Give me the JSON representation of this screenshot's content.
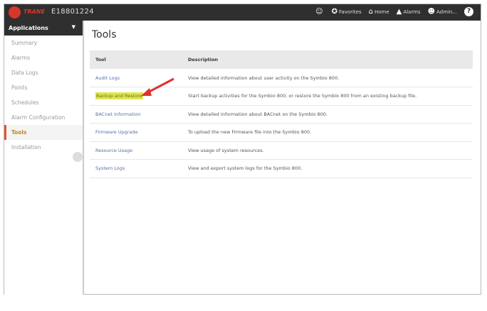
{
  "topbar": {
    "brand": "TRANE",
    "device": "E18801224",
    "nav": [
      {
        "icon": "user-icon",
        "label": ""
      },
      {
        "icon": "star-icon",
        "label": "Favorites"
      },
      {
        "icon": "home-icon",
        "label": "Home"
      },
      {
        "icon": "bell-icon",
        "label": "Alarms"
      },
      {
        "icon": "users-icon",
        "label": "Admin..."
      }
    ],
    "help": "?"
  },
  "sidebar": {
    "header": "Applications",
    "items": [
      "Summary",
      "Alarms",
      "Data Logs",
      "Points",
      "Schedules",
      "Alarm Configuration",
      "Tools",
      "Installation"
    ],
    "active": "Tools"
  },
  "main": {
    "title": "Tools",
    "columns": [
      "Tool",
      "Description"
    ],
    "rows": [
      {
        "tool": "Audit Logs",
        "desc": "View detailed information about user activity on the Symbio 800."
      },
      {
        "tool": "Backup and Restore",
        "desc": "Start backup activities for the Symbio 800, or restore the Symbio 800 from an existing backup file."
      },
      {
        "tool": "BACnet Information",
        "desc": "View detailed information about BACnet on the Symbio 800."
      },
      {
        "tool": "Firmware Upgrade",
        "desc": "To upload the new Firmware file into the Symbio 800."
      },
      {
        "tool": "Resource Usage",
        "desc": "View usage of system resources."
      },
      {
        "tool": "System Logs",
        "desc": "View and export system logs for the Symbio 800."
      }
    ]
  },
  "colors": {
    "accent": "#d9362a",
    "highlight": "#dfe84a",
    "link": "#5a6fa8"
  }
}
